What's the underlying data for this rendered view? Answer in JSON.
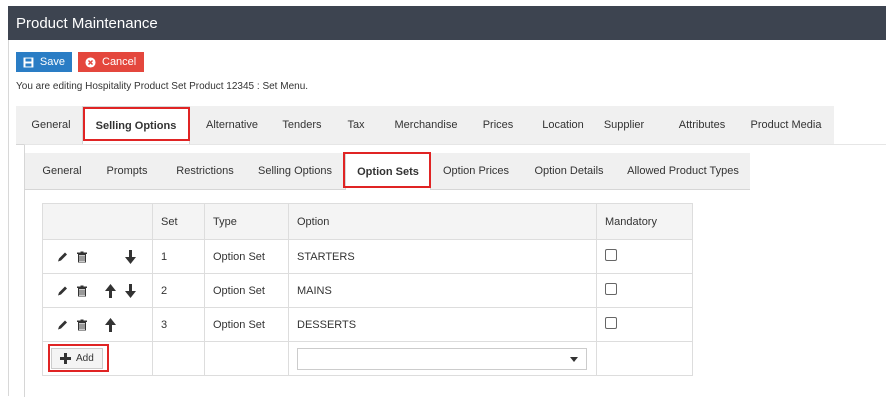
{
  "window": {
    "title": "Product Maintenance"
  },
  "toolbar": {
    "save_label": "Save",
    "cancel_label": "Cancel"
  },
  "editing_text": "You are editing Hospitality Product Set Product 12345 : Set Menu.",
  "main_tabs": [
    "General",
    "Selling Options",
    "Alternative",
    "Tenders",
    "Tax",
    "Merchandise",
    "Prices",
    "Location",
    "Supplier",
    "Attributes",
    "Product Media"
  ],
  "active_main_tab": "Selling Options",
  "sub_tabs": [
    "General",
    "Prompts",
    "Restrictions",
    "Selling Options",
    "Option Sets",
    "Option Prices",
    "Option Details",
    "Allowed Product Types"
  ],
  "active_sub_tab": "Option Sets",
  "table": {
    "headers": [
      "",
      "Set",
      "Type",
      "Option",
      "Mandatory"
    ],
    "rows": [
      {
        "set": "1",
        "type": "Option Set",
        "option": "STARTERS",
        "mandatory": false
      },
      {
        "set": "2",
        "type": "Option Set",
        "option": "MAINS",
        "mandatory": false
      },
      {
        "set": "3",
        "type": "Option Set",
        "option": "DESSERTS",
        "mandatory": false
      }
    ],
    "add_label": "Add",
    "new_option_value": ""
  },
  "colors": {
    "title_bar": "#3d4450",
    "save_button": "#2a7dc5",
    "cancel_button": "#e4473d",
    "highlight": "#e02424"
  }
}
